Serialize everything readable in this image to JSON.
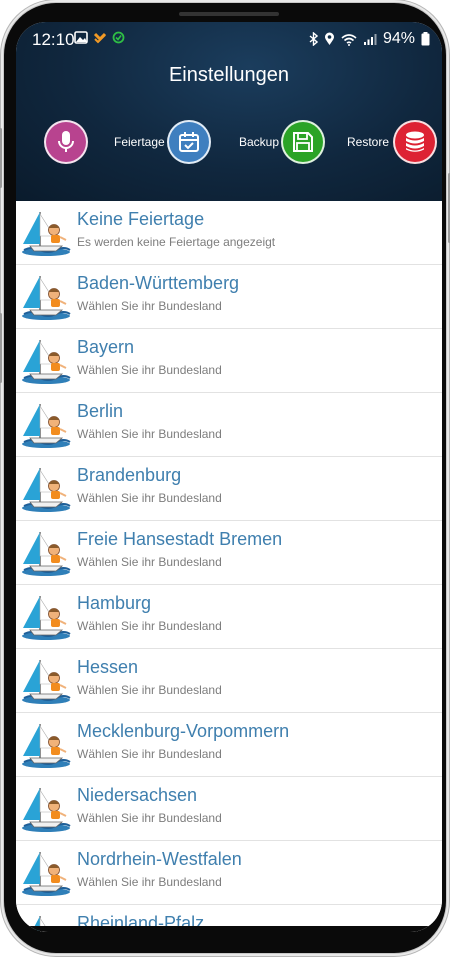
{
  "status_bar": {
    "time": "12:10",
    "battery": "94%",
    "left_icons": [
      "image-icon",
      "app-notification-icon",
      "sync-icon"
    ],
    "right_icons": [
      "bluetooth-icon",
      "location-icon",
      "wifi-icon",
      "signal-icon",
      "battery-icon"
    ]
  },
  "header": {
    "title": "Einstellungen",
    "actions": [
      {
        "id": "microphone",
        "label": "",
        "color": "#b8438f",
        "icon": "microphone-icon"
      },
      {
        "id": "feiertage",
        "label": "Feiertage",
        "color": "#3f7fbf",
        "icon": "calendar-check-icon"
      },
      {
        "id": "backup",
        "label": "Backup",
        "color": "#2ba326",
        "icon": "floppy-disk-icon"
      },
      {
        "id": "restore",
        "label": "Restore",
        "color": "#dd2233",
        "icon": "database-icon"
      }
    ]
  },
  "list": {
    "items": [
      {
        "title": "Keine Feiertage",
        "subtitle": "Es werden keine Feiertage angezeigt"
      },
      {
        "title": "Baden-Württemberg",
        "subtitle": "Wählen Sie ihr Bundesland"
      },
      {
        "title": "Bayern",
        "subtitle": "Wählen Sie ihr Bundesland"
      },
      {
        "title": "Berlin",
        "subtitle": "Wählen Sie ihr Bundesland"
      },
      {
        "title": "Brandenburg",
        "subtitle": "Wählen Sie ihr Bundesland"
      },
      {
        "title": "Freie Hansestadt Bremen",
        "subtitle": "Wählen Sie ihr Bundesland"
      },
      {
        "title": "Hamburg",
        "subtitle": "Wählen Sie ihr Bundesland"
      },
      {
        "title": "Hessen",
        "subtitle": "Wählen Sie ihr Bundesland"
      },
      {
        "title": "Mecklenburg-Vorpommern",
        "subtitle": "Wählen Sie ihr Bundesland"
      },
      {
        "title": "Niedersachsen",
        "subtitle": "Wählen Sie ihr Bundesland"
      },
      {
        "title": "Nordrhein-Westfalen",
        "subtitle": "Wählen Sie ihr Bundesland"
      },
      {
        "title": "Rheinland-Pfalz",
        "subtitle": ""
      }
    ]
  },
  "colors": {
    "header_bg": "#10273e",
    "title_text": "#3f7fae",
    "subtitle_text": "#7d7d7d"
  }
}
